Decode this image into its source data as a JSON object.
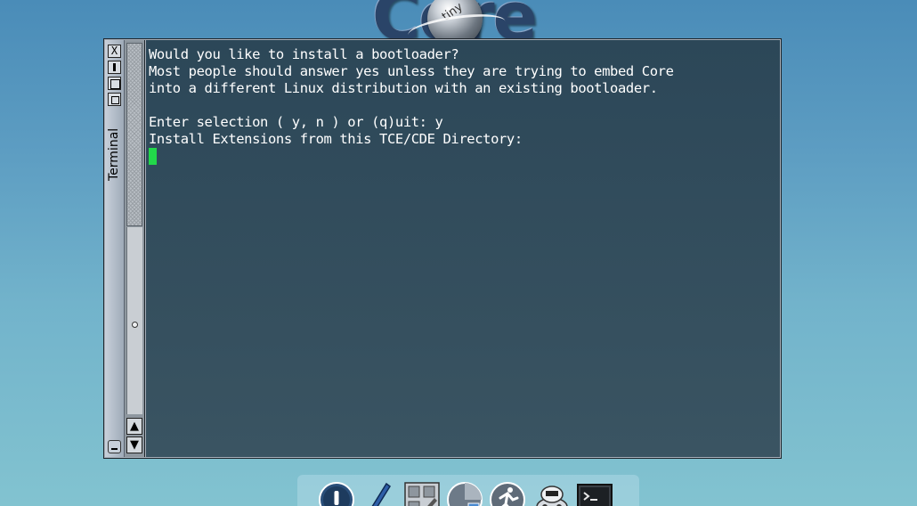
{
  "desktop": {
    "logo": {
      "main_text": "Core",
      "small_text": "tiny"
    }
  },
  "window": {
    "title": "Terminal",
    "buttons": {
      "close": "X"
    }
  },
  "scrollbar": {
    "up_arrow": "▲",
    "down_arrow": "▼"
  },
  "terminal": {
    "lines": [
      "Would you like to install a bootloader?",
      "Most people should answer yes unless they are trying to embed Core",
      "into a different Linux distribution with an existing bootloader.",
      "",
      "Enter selection ( y, n ) or (q)uit: y",
      "Install Extensions from this TCE/CDE Directory:"
    ],
    "cursor_color": "#22d84a"
  },
  "dock": {
    "icons": [
      "power-icon",
      "editor-icon",
      "apps-icon",
      "control-panel-icon",
      "run-icon",
      "mount-tool-icon",
      "terminal-icon"
    ]
  }
}
